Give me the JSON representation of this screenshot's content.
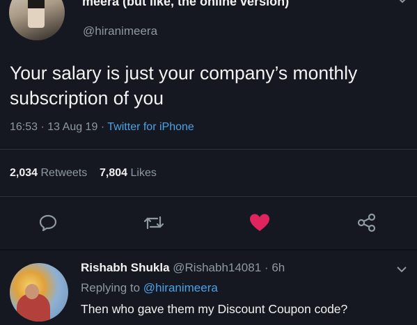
{
  "tweet": {
    "display_name": "meera (but like, the online version)",
    "handle": "@hiranimeera",
    "text": "Your salary is just your company’s monthly subscription of you",
    "time": "16:53",
    "date": "13 Aug 19",
    "client": "Twitter for iPhone",
    "sep": "·",
    "retweet_count": "2,034",
    "retweet_label": "Retweets",
    "like_count": "7,804",
    "like_label": "Likes",
    "liked": true,
    "colors": {
      "background": "#151820",
      "link": "#4aa3e6",
      "like": "#e0245e",
      "muted": "#8e99a4"
    },
    "actions": [
      "reply-icon",
      "retweet-icon",
      "heart-icon",
      "share-icon"
    ]
  },
  "reply": {
    "name": "Rishabh Shukla",
    "handle": "@Rishabh14081",
    "age": "6h",
    "sep": "·",
    "replying_prefix": "Replying to",
    "replying_handle": "@hiranimeera",
    "text": "Then who gave them my Discount Coupon code?"
  }
}
